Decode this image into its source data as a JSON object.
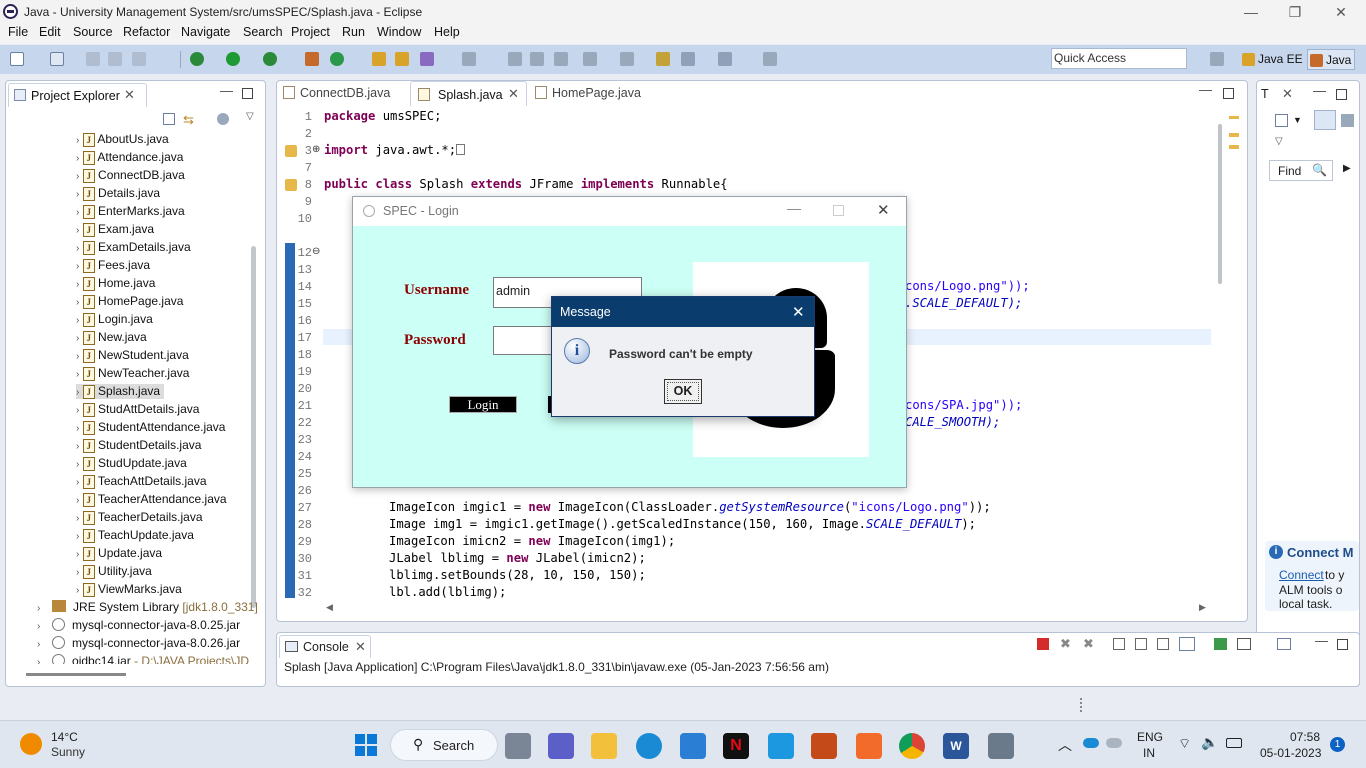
{
  "window": {
    "title": "Java - University Management System/src/umsSPEC/Splash.java - Eclipse",
    "controls": [
      "—",
      "❐",
      "✕"
    ]
  },
  "menu": [
    "File",
    "Edit",
    "Source",
    "Refactor",
    "Navigate",
    "Search",
    "Project",
    "Run",
    "Window",
    "Help"
  ],
  "toolbar": {
    "quick_access_placeholder": "Quick Access",
    "perspectives": [
      "Java EE",
      "Java"
    ]
  },
  "project_explorer": {
    "title": "Project Explorer",
    "files": [
      "AboutUs.java",
      "Attendance.java",
      "ConnectDB.java",
      "Details.java",
      "EnterMarks.java",
      "Exam.java",
      "ExamDetails.java",
      "Fees.java",
      "Home.java",
      "HomePage.java",
      "Login.java",
      "New.java",
      "NewStudent.java",
      "NewTeacher.java",
      "Splash.java",
      "StudAttDetails.java",
      "StudentAttendance.java",
      "StudentDetails.java",
      "StudUpdate.java",
      "TeachAttDetails.java",
      "TeacherAttendance.java",
      "TeacherDetails.java",
      "TeachUpdate.java",
      "Update.java",
      "Utility.java",
      "ViewMarks.java"
    ],
    "selected_file": "Splash.java",
    "libraries": {
      "jre_label": "JRE System Library",
      "jre_version": "[jdk1.8.0_331]",
      "jars": [
        "mysql-connector-java-8.0.25.jar",
        "mysql-connector-java-8.0.26.jar",
        "ojdbc14.jar"
      ],
      "ojdbc_path": "- D:\\JAVA Projects\\JD"
    }
  },
  "editor": {
    "tabs": [
      "ConnectDB.java",
      "Splash.java",
      "HomePage.java"
    ],
    "active_tab": "Splash.java",
    "line_numbers": [
      "1",
      "2",
      "3",
      "7",
      "8",
      "9",
      "10",
      "12",
      "13",
      "14",
      "15",
      "16",
      "17",
      "18",
      "19",
      "20",
      "21",
      "22",
      "23",
      "24",
      "25",
      "26",
      "27",
      "28",
      "29",
      "30",
      "31",
      "32"
    ],
    "fragments": {
      "logo_png_tail": "cons/Logo.png\"));",
      "scale_default_tail": ".SCALE_DEFAULT);",
      "spa_tail": "cons/SPA.jpg\"));",
      "scale_smooth_tail": "CALE_SMOOTH);"
    }
  },
  "splash_window": {
    "title": "SPEC - Login",
    "username_label": "Username",
    "username_value": "admin",
    "password_label": "Password",
    "password_value": "",
    "login_button": "Login"
  },
  "message_dialog": {
    "title": "Message",
    "text": "Password can't be empty",
    "ok_button": "OK"
  },
  "right_pane": {
    "tab_label": "T",
    "find_label": "Find",
    "connect_title": "Connect M",
    "connect_link": "Connect",
    "connect_rest1": "to y",
    "connect_rest2": "ALM tools o",
    "connect_rest3": "local task."
  },
  "console": {
    "title": "Console",
    "line": "Splash [Java Application] C:\\Program Files\\Java\\jdk1.8.0_331\\bin\\javaw.exe (05-Jan-2023 7:56:56 am)"
  },
  "taskbar": {
    "weather_temp": "14°C",
    "weather_desc": "Sunny",
    "search_label": "Search",
    "language": "ENG",
    "region": "IN",
    "time": "07:58",
    "date": "05-01-2023",
    "notification_count": "1"
  }
}
